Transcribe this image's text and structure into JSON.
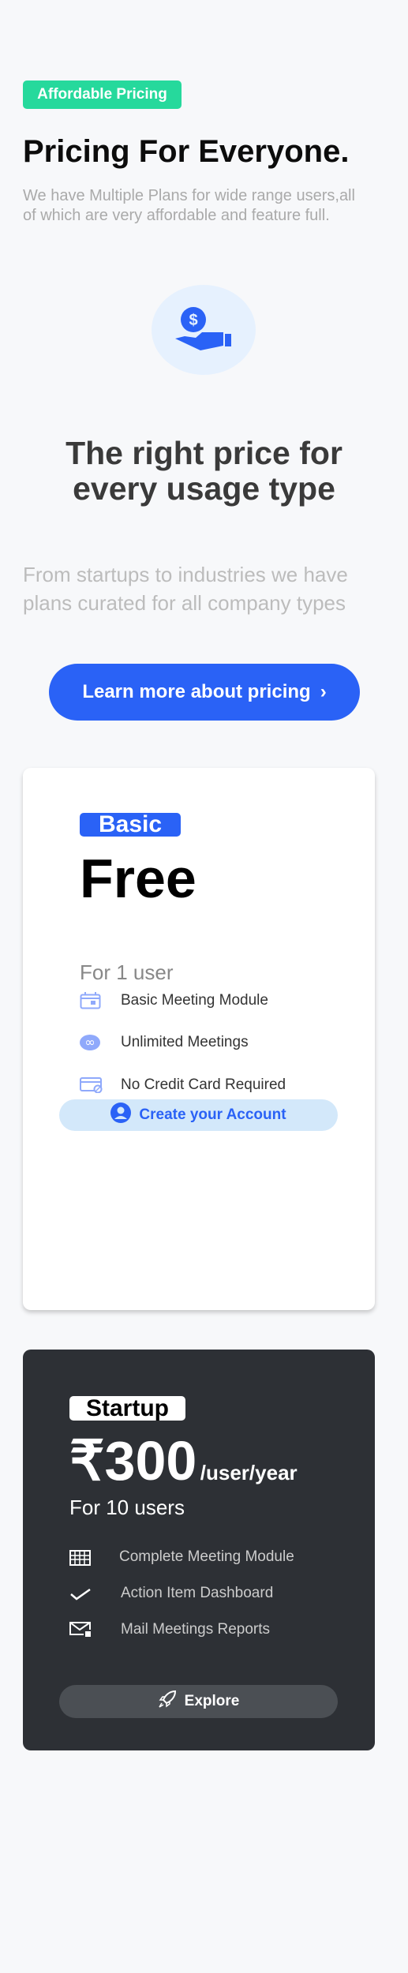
{
  "header": {
    "tag": "Affordable Pricing",
    "title": "Pricing For Everyone.",
    "subtitle": "We have Multiple Plans for wide range users,all of which are very affordable and feature full."
  },
  "hero": {
    "heading": "The right price for every usage type",
    "text": "From startups to industries we have plans curated for all company types",
    "cta": "Learn more about pricing",
    "accent": "#2a62f6"
  },
  "plans": [
    {
      "badge": "Basic",
      "price": "Free",
      "users": "For 1 user",
      "features": [
        "Basic Meeting Module",
        "Unlimited Meetings",
        "No Credit Card Required"
      ],
      "button": "Create your Account"
    },
    {
      "badge": "Startup",
      "price": "₹300",
      "period": "/user/year",
      "users": "For 10 users",
      "features": [
        "Complete Meeting Module",
        "Action Item Dashboard",
        "Mail Meetings Reports"
      ],
      "button": "Explore"
    }
  ]
}
